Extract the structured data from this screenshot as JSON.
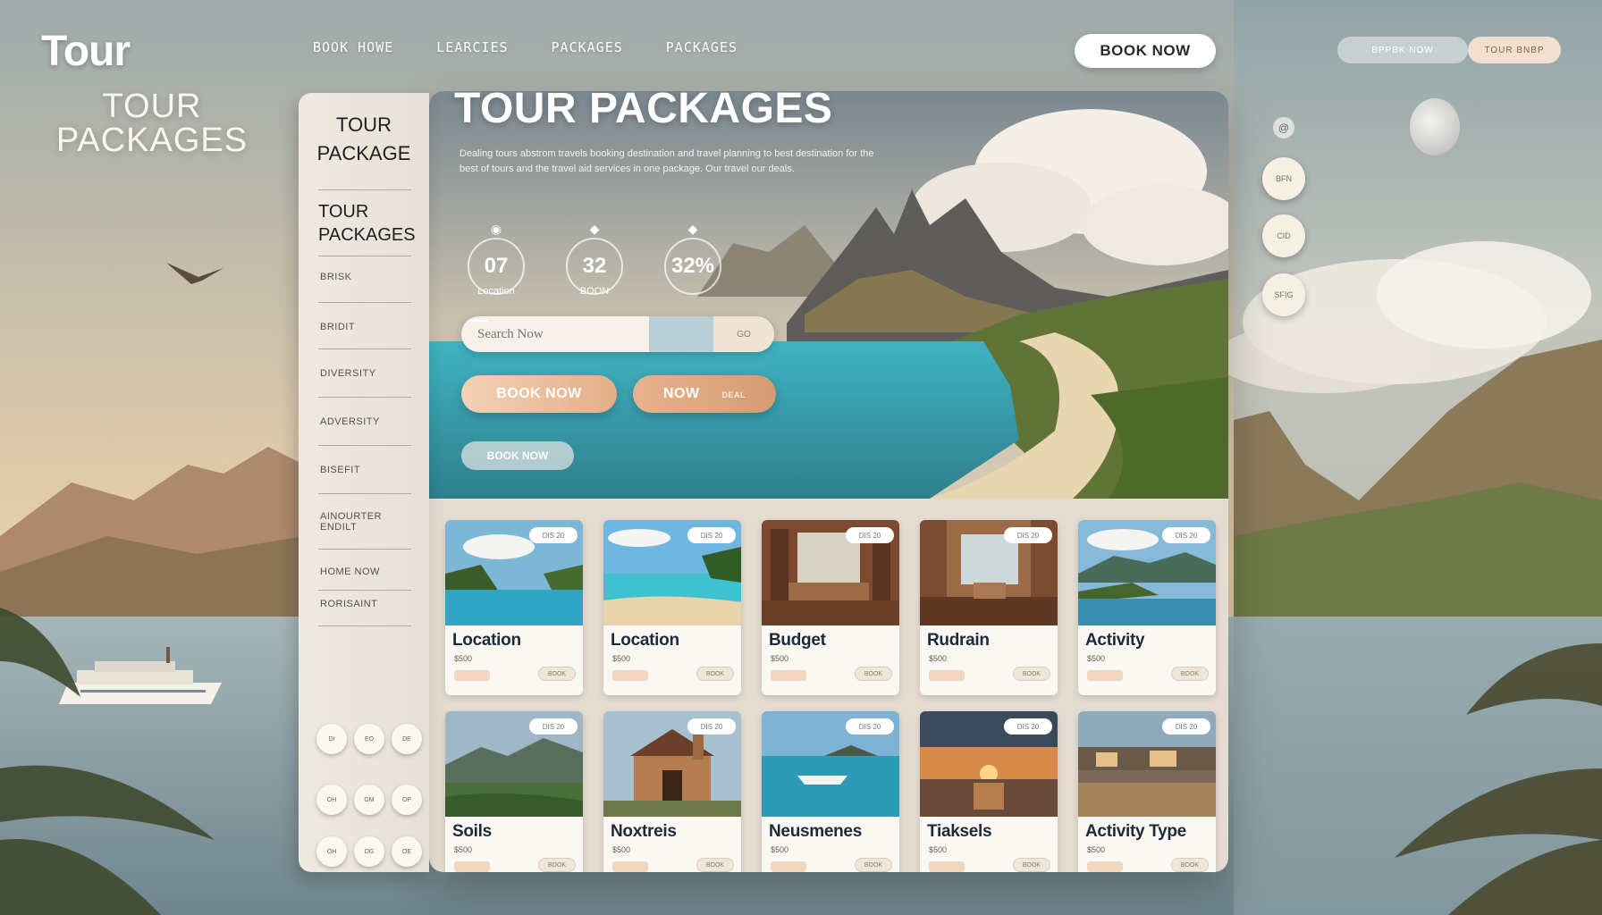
{
  "brand": {
    "logo": "Tour",
    "subtitle": "TOUR PACKAGES"
  },
  "nav": {
    "links": [
      "BOOK HOWE",
      "LEARCIES",
      "PACKAGES",
      "PACKAGES"
    ],
    "book_button": "BOOK NOW",
    "pill_a": "BPPBK NOW",
    "pill_b": "TOUR BNBP"
  },
  "sidebar": {
    "heading": "TOUR PACKAGE",
    "subheading": "TOUR PACKAGES",
    "items": [
      "BRISK",
      "BRIDIT",
      "DIVERSITY",
      "ADVERSITY",
      "BISEFIT",
      "AINOURTER ENDILT",
      "HOME NOW",
      "RORISAINT"
    ],
    "footer_dots": [
      "DI",
      "EO",
      "DE",
      "OH",
      "GM",
      "OP",
      "OH",
      "DG",
      "OE"
    ]
  },
  "hero": {
    "title": "TOUR PACKAGES",
    "description": "Dealing tours abstrom travels booking destination and travel planning to best destination for the best of tours and the travel aid services in one package. Our travel our deals.",
    "stats": [
      {
        "value": "07",
        "label": "Location",
        "icon": "pin-icon"
      },
      {
        "value": "32",
        "label": "BOON",
        "icon": "diamond-icon"
      },
      {
        "value": "32%",
        "label": "",
        "icon": "diamond-icon"
      }
    ],
    "search_placeholder": "Search Now",
    "search_go": "GO",
    "book_button": "BOOK NOW",
    "now_button": "NOW",
    "now_tag": "DEAL",
    "ghost_button": "BOOK NOW"
  },
  "cards": [
    {
      "title": "Location",
      "price": "$500",
      "badge": "DIS 20",
      "action": "BOOK",
      "scene": "beach"
    },
    {
      "title": "Location",
      "price": "$500",
      "badge": "DIS 20",
      "action": "BOOK",
      "scene": "beach2"
    },
    {
      "title": "Budget",
      "price": "$500",
      "badge": "DIS 20",
      "action": "BOOK",
      "scene": "room"
    },
    {
      "title": "Rudrain",
      "price": "$500",
      "badge": "DIS 20",
      "action": "BOOK",
      "scene": "lobby"
    },
    {
      "title": "Activity",
      "price": "$500",
      "badge": "DIS 20",
      "action": "BOOK",
      "scene": "lake"
    },
    {
      "title": "Soils",
      "price": "$500",
      "badge": "DIS 20",
      "action": "BOOK",
      "scene": "mountain"
    },
    {
      "title": "Noxtreis",
      "price": "$500",
      "badge": "DIS 20",
      "action": "BOOK",
      "scene": "church"
    },
    {
      "title": "Neusmenes",
      "price": "$500",
      "badge": "DIS 20",
      "action": "BOOK",
      "scene": "boat"
    },
    {
      "title": "Tiaksels",
      "price": "$500",
      "badge": "DIS 20",
      "action": "BOOK",
      "scene": "sunset"
    },
    {
      "title": "Activity Type",
      "price": "$500",
      "badge": "DIS 20",
      "action": "BOOK",
      "scene": "harbor"
    }
  ],
  "floating": {
    "buttons": [
      "BFN",
      "CID",
      "SFIG"
    ],
    "mini_icon": "spiral-icon"
  },
  "colors": {
    "accent": "#e3ae88",
    "panel": "#e5dcd1",
    "sea": "#3fb3c2"
  }
}
